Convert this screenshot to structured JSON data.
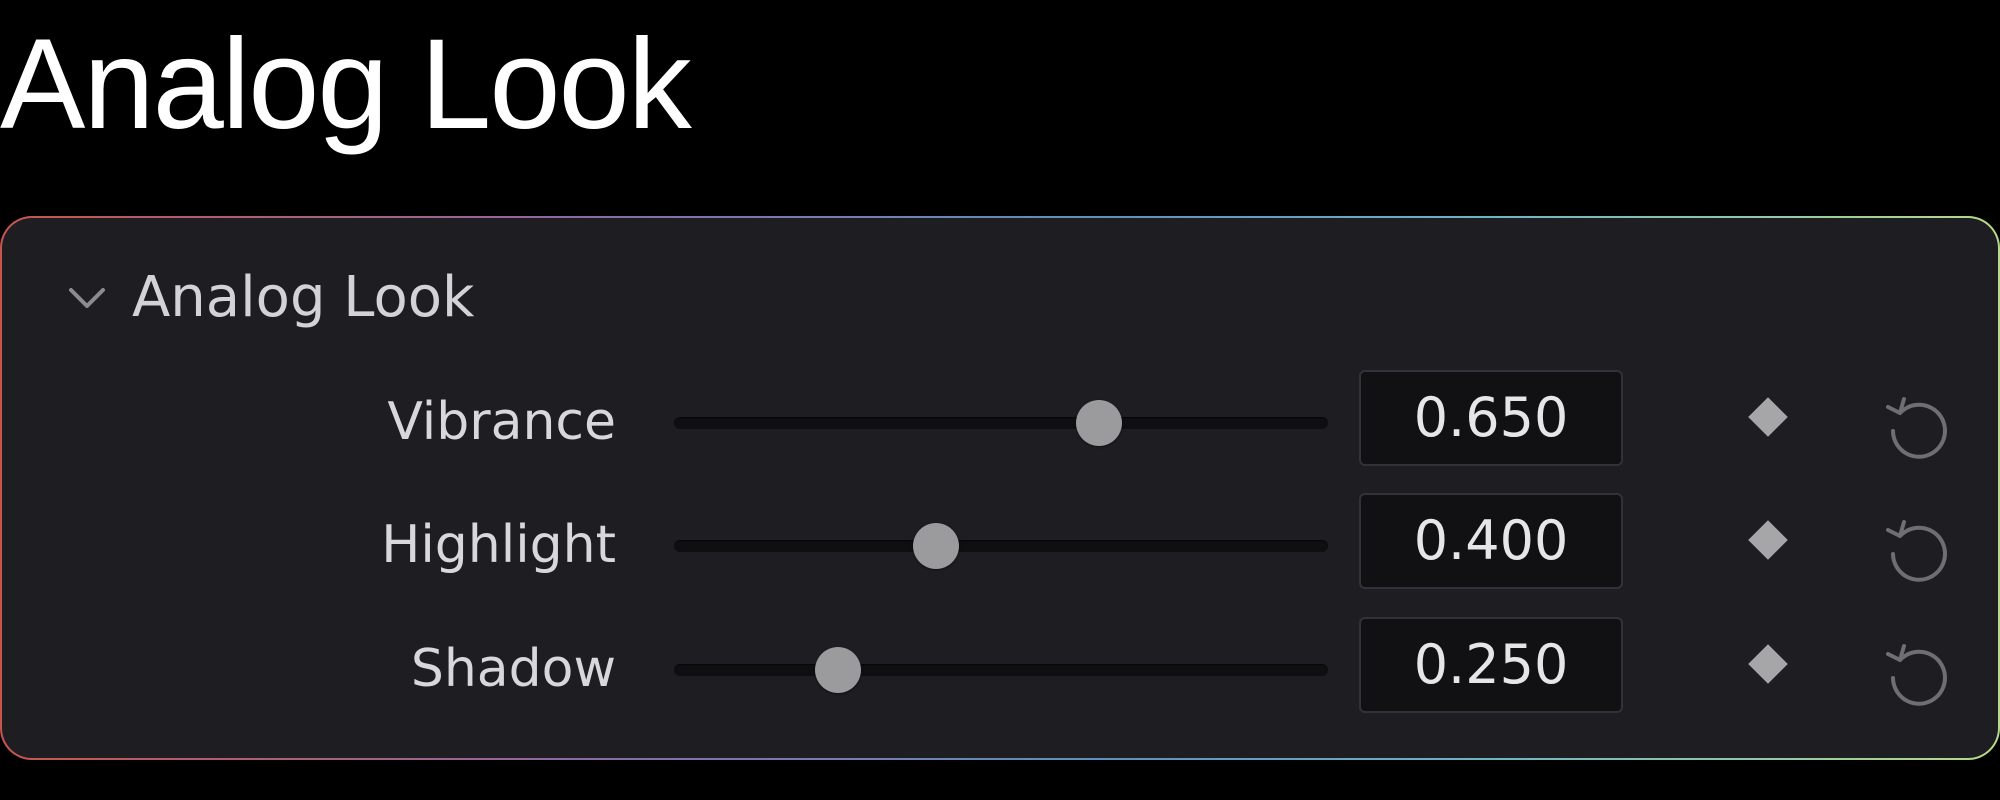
{
  "page": {
    "title": "Analog Look"
  },
  "panel": {
    "title": "Analog Look",
    "expanded": true,
    "icons": {
      "toggle": "chevron-down-icon",
      "keyframe": "keyframe-diamond-icon",
      "reset": "reset-icon"
    },
    "rows": [
      {
        "label": "Vibrance",
        "value": "0.650",
        "level": 0.65
      },
      {
        "label": "Highlight",
        "value": "0.400",
        "level": 0.4
      },
      {
        "label": "Shadow",
        "value": "0.250",
        "level": 0.25
      }
    ]
  },
  "colors": {
    "background": "#000000",
    "panel_background": "#1e1e22",
    "title_text": "#ffffff",
    "label_text": "#d8d8da",
    "slider_track": "#0f0f11",
    "slider_thumb": "#9b9b9e",
    "field_background": "#111113",
    "field_border": "#323238",
    "keyframe_icon": "#a6a6a8",
    "reset_icon": "#6f6f72",
    "border_gradient": [
      "#c9554f",
      "#8a6aa8",
      "#5f8fc0",
      "#6cb7c4",
      "#b9d88a"
    ]
  }
}
